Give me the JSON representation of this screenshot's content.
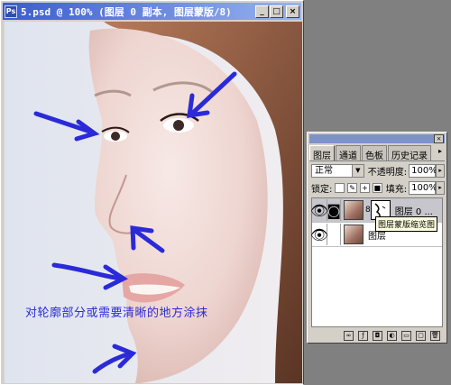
{
  "document": {
    "title": "5.psd @ 100% (图层 0 副本, 图层蒙版/8)",
    "controls": {
      "minimize": "_",
      "maximize": "□",
      "close": "×"
    },
    "caption": "对轮廓部分或需要清晰的地方涂抹",
    "annotation_color": "#2a2ad8"
  },
  "layers_panel": {
    "tabs": [
      "图层",
      "通道",
      "色板",
      "历史记录"
    ],
    "active_tab": "图层",
    "blend_mode": "正常",
    "opacity_label": "不透明度:",
    "opacity_value": "100%",
    "lock_label": "锁定:",
    "fill_label": "填充:",
    "fill_value": "100%",
    "layers": [
      {
        "name": "图层 0 ...",
        "selected": true,
        "has_mask": true
      },
      {
        "name": "图层",
        "selected": false,
        "has_mask": false
      }
    ],
    "tooltip": "图层蒙版缩览图",
    "bottom_icons": [
      "link-layers-icon",
      "layer-style-icon",
      "add-mask-icon",
      "adjustment-layer-icon",
      "new-group-icon",
      "new-layer-icon",
      "trash-icon"
    ]
  }
}
